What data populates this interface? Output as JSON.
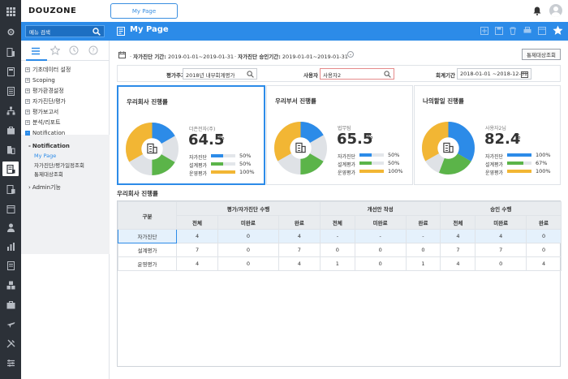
{
  "header": {
    "logo": "DOUZONE",
    "tab_label": "My Page"
  },
  "toolbar": {
    "search_placeholder": "메뉴 검색",
    "page_title": "My Page"
  },
  "sidebar": {
    "items": [
      {
        "label": "기초데이터 설정",
        "box": "+"
      },
      {
        "label": "Scoping",
        "box": "+"
      },
      {
        "label": "평가환경설정",
        "box": "+"
      },
      {
        "label": "자가진단/평가",
        "box": "+"
      },
      {
        "label": "평가보고서",
        "box": "+"
      },
      {
        "label": "분석/리포트",
        "box": "+"
      },
      {
        "label": "Notification",
        "box": "-"
      }
    ],
    "notification_group": "Notification",
    "sub_items": [
      "My Page",
      "자가진단/평가일정조회",
      "통제대상조회"
    ],
    "admin": "Admin기능"
  },
  "filters": {
    "self_period_label": "자가진단 기간:",
    "self_period_value": "2019-01-01~2019-01-31",
    "approve_period_label": "자가진단 승인기간:",
    "approve_period_value": "2019-01-01~2019-01-31",
    "target_button": "통제대상조회",
    "cycle_label": "평가주기",
    "cycle_value": "2018년 내부회계평가",
    "user_label": "사용자",
    "user_value": "사용자2",
    "fiscal_label": "회계기간",
    "fiscal_value": "2018-01-01 ~2018-12-31"
  },
  "cards": [
    {
      "title": "우리회사 진행률",
      "unit": "더존전자(주)",
      "percent": "64.5",
      "pct_sign": "%",
      "rows": [
        {
          "label": "자가진단",
          "value": "50",
          "pct": 50,
          "color": "#2c8be8"
        },
        {
          "label": "설계평가",
          "value": "50",
          "pct": 50,
          "color": "#5bb449"
        },
        {
          "label": "운영평가",
          "value": "100",
          "pct": 100,
          "color": "#f2b634"
        }
      ]
    },
    {
      "title": "우리부서 진행률",
      "unit": "법무팀",
      "percent": "65.5",
      "pct_sign": "%",
      "rows": [
        {
          "label": "자가진단",
          "value": "50",
          "pct": 50,
          "color": "#2c8be8"
        },
        {
          "label": "설계평가",
          "value": "50",
          "pct": 50,
          "color": "#5bb449"
        },
        {
          "label": "운영평가",
          "value": "100",
          "pct": 100,
          "color": "#f2b634"
        }
      ]
    },
    {
      "title": "나의할일 진행률",
      "unit": "사용자2님",
      "percent": "82.4",
      "pct_sign": "%",
      "rows": [
        {
          "label": "자가진단",
          "value": "100",
          "pct": 100,
          "color": "#2c8be8"
        },
        {
          "label": "설계평가",
          "value": "67",
          "pct": 67,
          "color": "#5bb449"
        },
        {
          "label": "운영평가",
          "value": "100",
          "pct": 100,
          "color": "#f2b634"
        }
      ]
    }
  ],
  "table": {
    "section_title": "우리회사 진행률",
    "header_gubun": "구분",
    "groups": [
      "평가/자가진단 수행",
      "개선안 작성",
      "승인 수행"
    ],
    "subheaders": [
      "전체",
      "미완료",
      "완료",
      "전체",
      "미완료",
      "완료",
      "전체",
      "미완료",
      "완료"
    ],
    "rows": [
      {
        "name": "자가진단",
        "cells": [
          "4",
          "0",
          "4",
          "-",
          "-",
          "-",
          "4",
          "4",
          "0"
        ]
      },
      {
        "name": "설계평가",
        "cells": [
          "7",
          "0",
          "7",
          "0",
          "0",
          "0",
          "7",
          "7",
          "0"
        ]
      },
      {
        "name": "운영평가",
        "cells": [
          "4",
          "0",
          "4",
          "1",
          "0",
          "1",
          "4",
          "0",
          "4"
        ]
      }
    ]
  },
  "colors": {
    "accent": "#2c8be8",
    "rail": "#2c3138",
    "green": "#5bb449",
    "yellow": "#f2b634",
    "gray": "#dfe2e6"
  }
}
